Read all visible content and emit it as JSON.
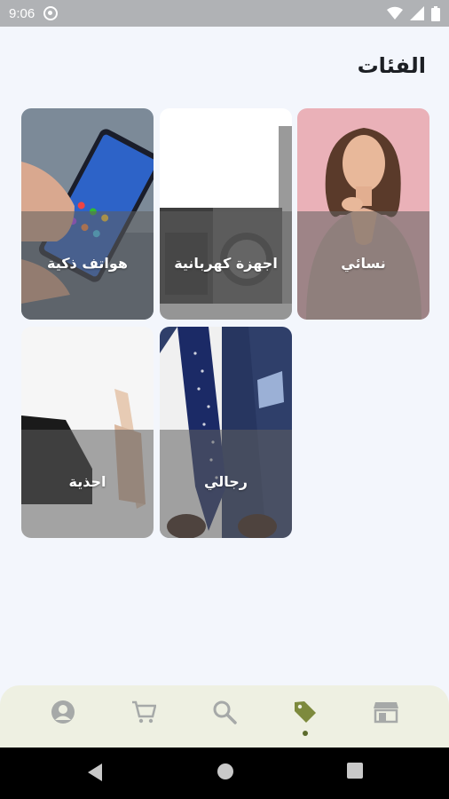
{
  "status_bar": {
    "time": "9:06"
  },
  "page": {
    "title": "الفئات"
  },
  "categories": [
    {
      "label": "نسائي"
    },
    {
      "label": "اجهزة كهربانية"
    },
    {
      "label": "هواتف ذكية"
    },
    {
      "label": "رجالي"
    },
    {
      "label": "احذية"
    }
  ],
  "bottom_nav": {
    "items": [
      "profile-icon",
      "cart-icon",
      "search-icon",
      "tag-icon",
      "store-icon"
    ],
    "active": "tag-icon",
    "accent_color": "#7d8a3d"
  }
}
